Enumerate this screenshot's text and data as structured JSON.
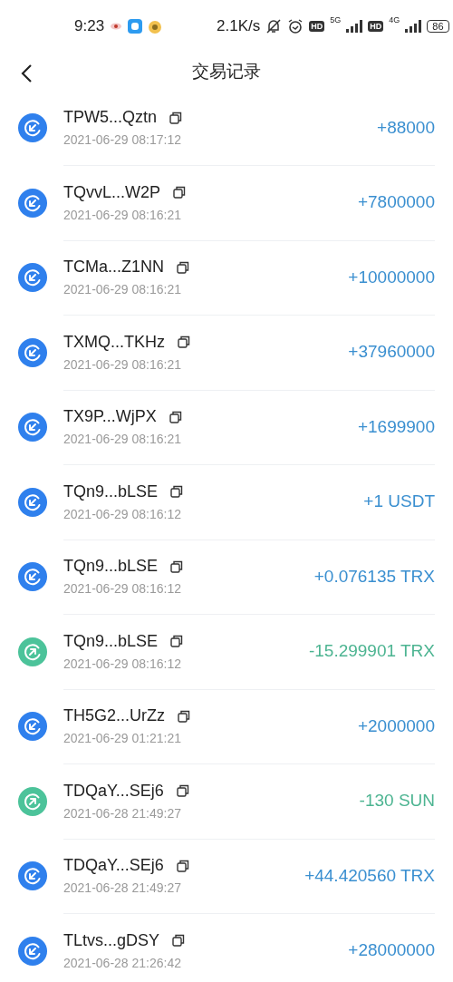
{
  "status_bar": {
    "time": "9:23",
    "speed": "2.1K/s",
    "sim_1": {
      "hd": "HD",
      "network": "5G"
    },
    "sim_2": {
      "hd": "HD",
      "network": "4G"
    },
    "battery": "86"
  },
  "header": {
    "title": "交易记录"
  },
  "transactions": [
    {
      "kind": "in",
      "address": "TPW5...Qztn",
      "time": "2021-06-29 08:17:12",
      "amount": "+88000"
    },
    {
      "kind": "in",
      "address": "TQvvL...W2P",
      "time": "2021-06-29 08:16:21",
      "amount": "+7800000"
    },
    {
      "kind": "in",
      "address": "TCMa...Z1NN",
      "time": "2021-06-29 08:16:21",
      "amount": "+10000000"
    },
    {
      "kind": "in",
      "address": "TXMQ...TKHz",
      "time": "2021-06-29 08:16:21",
      "amount": "+37960000"
    },
    {
      "kind": "in",
      "address": "TX9P...WjPX",
      "time": "2021-06-29 08:16:21",
      "amount": "+1699900"
    },
    {
      "kind": "in",
      "address": "TQn9...bLSE",
      "time": "2021-06-29 08:16:12",
      "amount": "+1 USDT"
    },
    {
      "kind": "in",
      "address": "TQn9...bLSE",
      "time": "2021-06-29 08:16:12",
      "amount": "+0.076135 TRX"
    },
    {
      "kind": "out",
      "address": "TQn9...bLSE",
      "time": "2021-06-29 08:16:12",
      "amount": "-15.299901 TRX"
    },
    {
      "kind": "in",
      "address": "TH5G2...UrZz",
      "time": "2021-06-29 01:21:21",
      "amount": "+2000000"
    },
    {
      "kind": "out",
      "address": "TDQaY...SEj6",
      "time": "2021-06-28 21:49:27",
      "amount": "-130 SUN"
    },
    {
      "kind": "in",
      "address": "TDQaY...SEj6",
      "time": "2021-06-28 21:49:27",
      "amount": "+44.420560 TRX"
    },
    {
      "kind": "in",
      "address": "TLtvs...gDSY",
      "time": "2021-06-28 21:26:42",
      "amount": "+28000000"
    }
  ]
}
